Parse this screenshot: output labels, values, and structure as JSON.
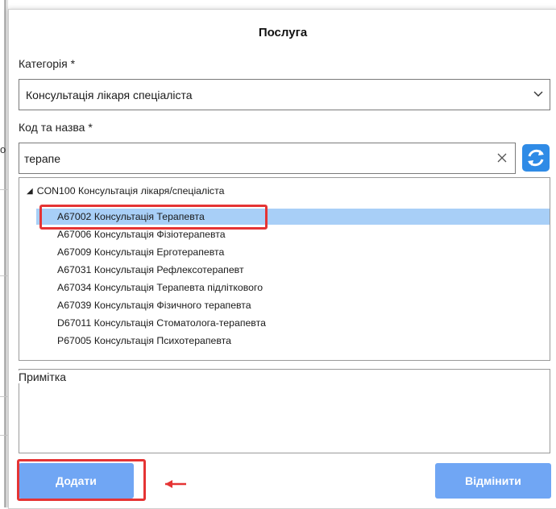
{
  "dialog": {
    "title": "Послуга",
    "category_label": "Категорія *",
    "category_value": "Консультація лікаря спеціаліста",
    "code_label": "Код та назва *",
    "search_value": "терапе",
    "tree": {
      "root": "CON100 Консультація лікаря/спеціаліста",
      "items": [
        "А67002 Консультація Терапевта",
        "А67006 Консультація Фізіотерапевта",
        "А67009 Консультація Ерготерапевта",
        "А67031 Консультація Рефлексотерапевт",
        "А67034 Консультація Терапевта підліткового",
        "А67039 Консультація Фізичного терапевта",
        "D67011 Консультація Стоматолога-терапевта",
        "P67005 Консультація Психотерапевта"
      ],
      "selected_index": 0
    },
    "note_label": "Примітка",
    "add_button": "Додати",
    "cancel_button": "Відмінити"
  },
  "background": {
    "glyph": "о"
  },
  "icons": {
    "chevron": "chevron-down-icon",
    "clear": "close-icon",
    "refresh": "refresh-icon",
    "tree_toggle": "caret-down-icon",
    "annotation": "arrow-left-icon"
  },
  "colors": {
    "accent": "#70a6f4",
    "selection": "#a8cff7",
    "highlight": "#e53434",
    "refresh": "#2f8be6"
  }
}
